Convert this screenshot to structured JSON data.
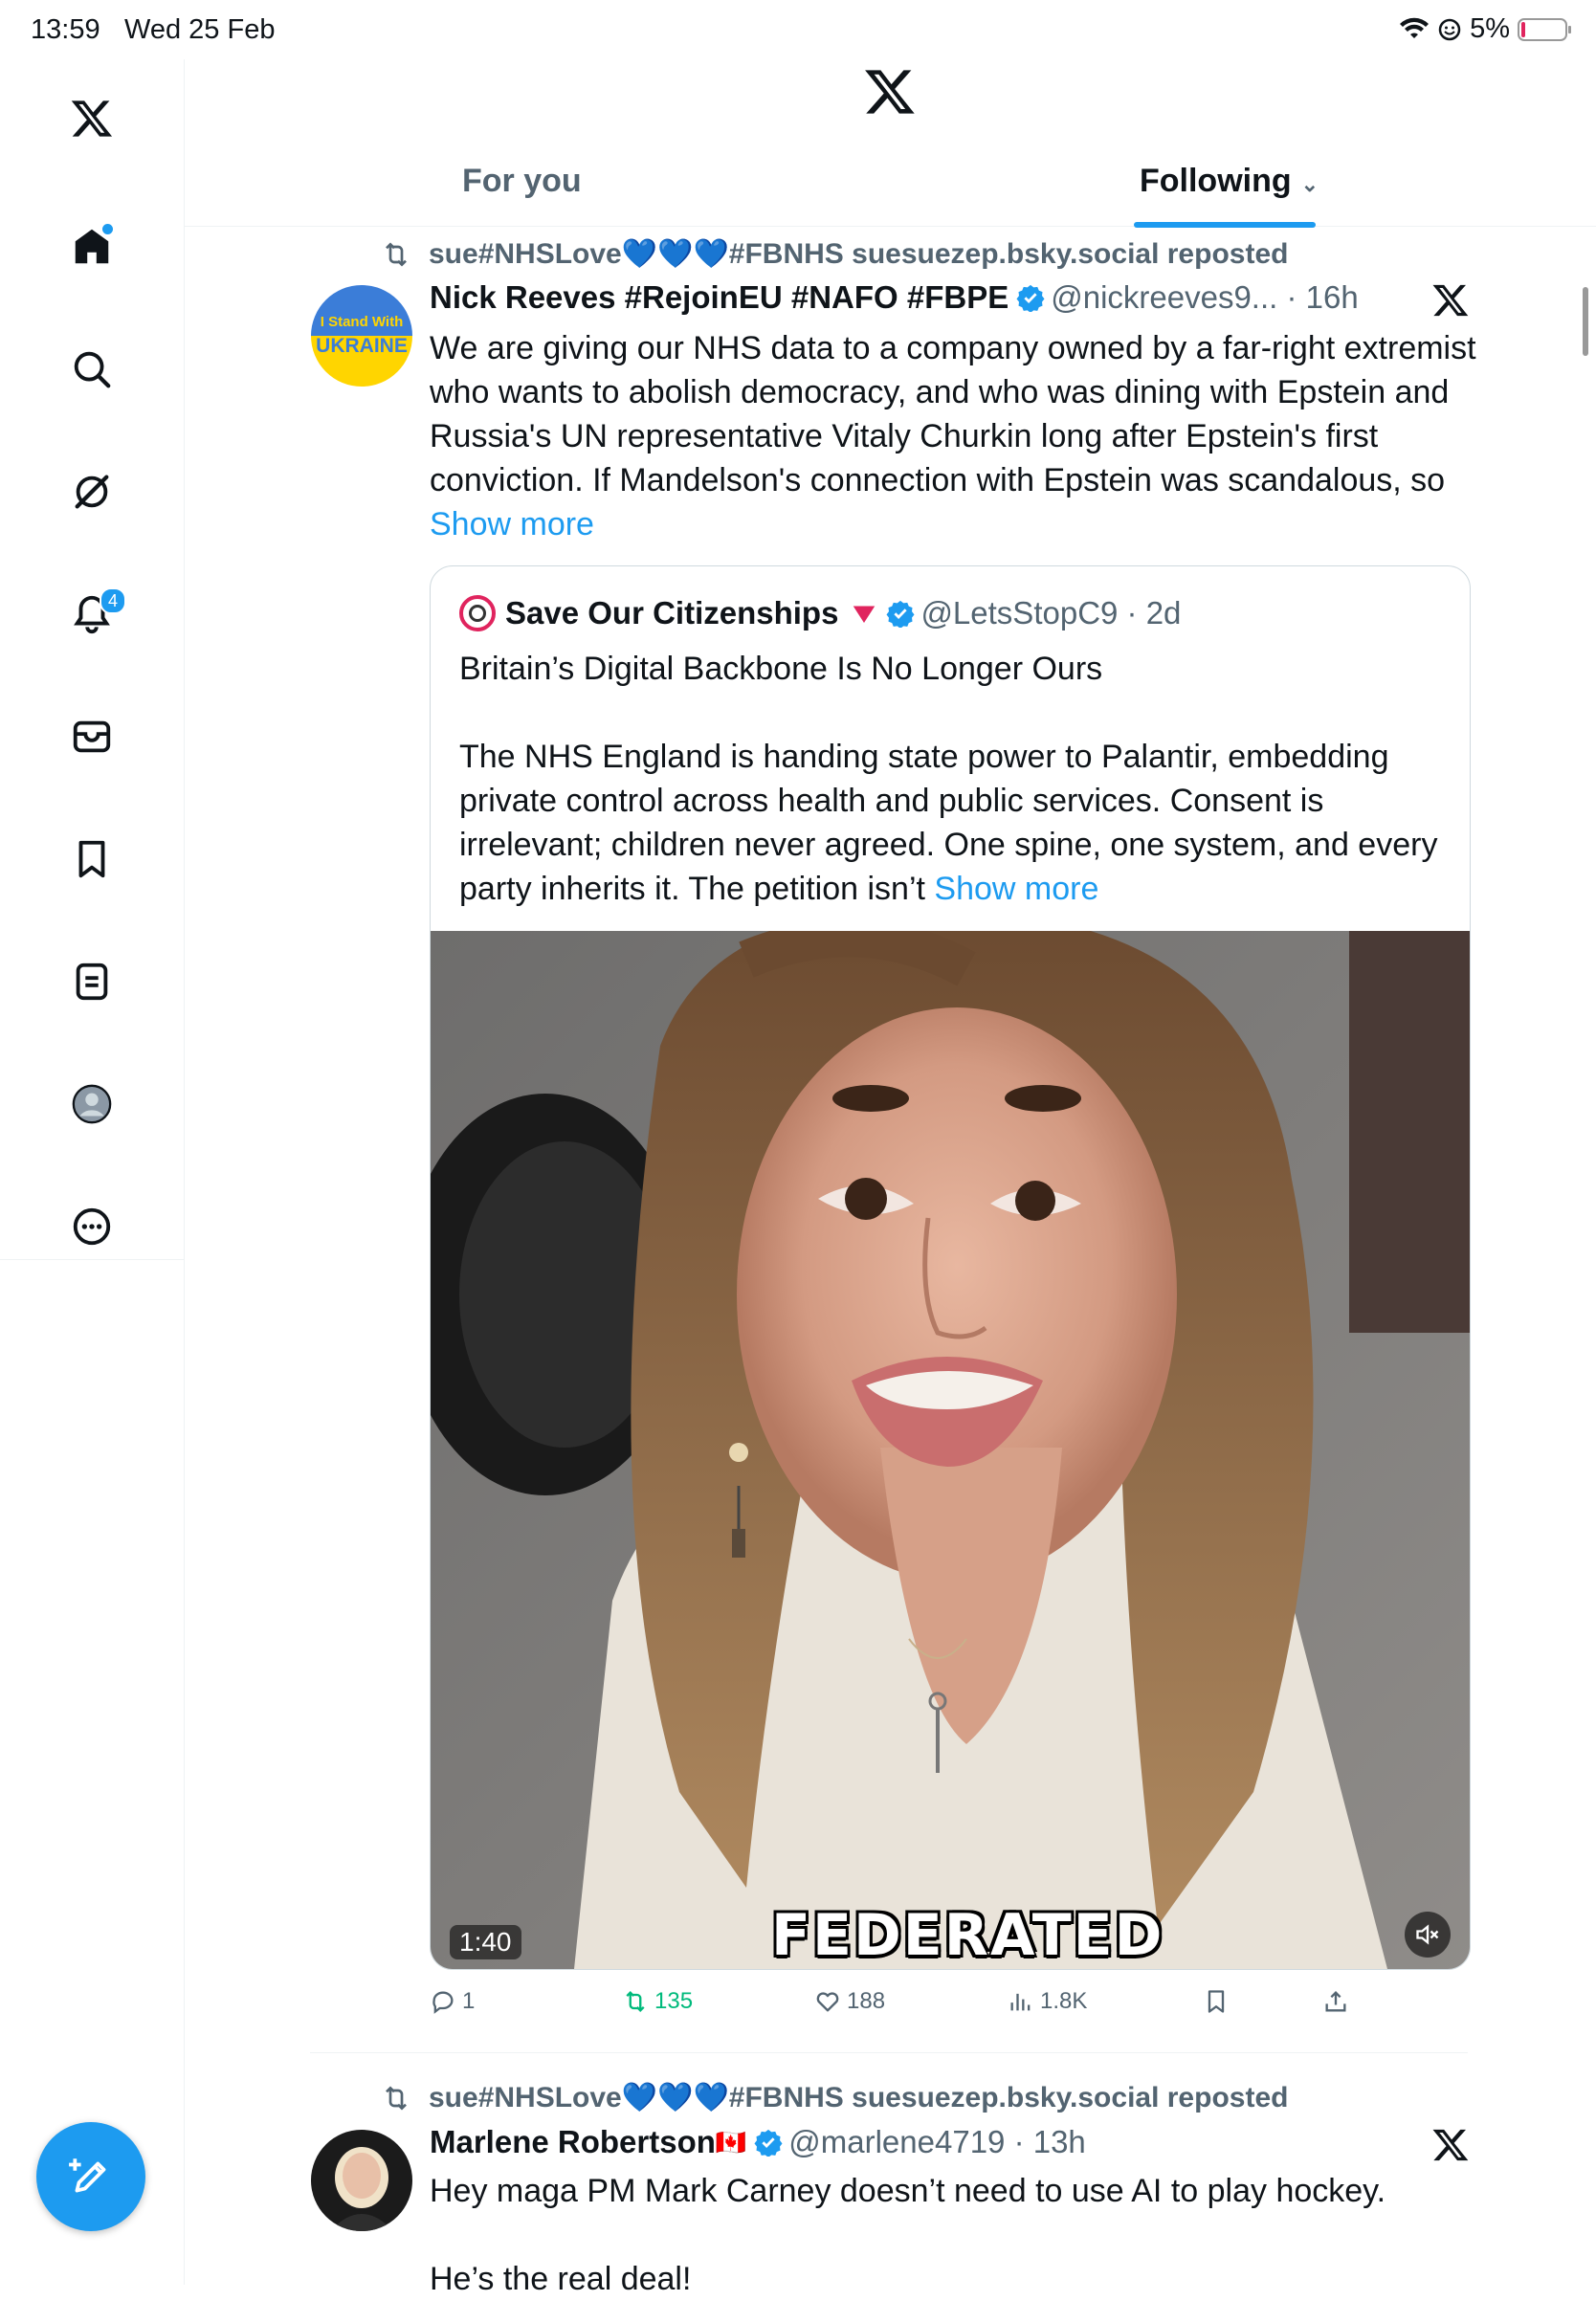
{
  "status_bar": {
    "time": "13:59",
    "date": "Wed 25 Feb",
    "battery": "5%"
  },
  "sidebar": {
    "notifications_badge": "4",
    "items": [
      "Home",
      "Search",
      "Grok",
      "Notifications",
      "Messages",
      "Bookmarks",
      "Lists",
      "Profile",
      "More"
    ]
  },
  "tabs": {
    "for_you": "For you",
    "following": "Following",
    "active": "following"
  },
  "posts": [
    {
      "repost_text": "sue#NHSLove💙💙💙#FBNHS suesuezep.bsky.social reposted",
      "author_name": "Nick Reeves #RejoinEU #NAFO #FBPE",
      "handle_time": "@nickreeves9... · 16h",
      "avatar_text_top": "I Stand With",
      "avatar_text_bottom": "UKRAINE",
      "text": "We are giving our NHS data to a company owned by a far-right extremist who wants to abolish democracy, and who was dining with Epstein and Russia's UN representative Vitaly Churkin long after Epstein's first conviction. If Mandelson's connection with Epstein was scandalous, so ",
      "show_more": "Show more",
      "quote": {
        "author_name": "Save Our Citizenships",
        "handle_time": "@LetsStopC9 · 2d",
        "title": "Britain’s Digital Backbone Is No Longer Ours",
        "text": "The NHS England is handing state power to Palantir, embedding private control across health and public services. Consent is irrelevant; children never agreed. One spine, one system, and every party inherits it. The petition isn’t ",
        "show_more": "Show more",
        "video_duration": "1:40",
        "video_caption": "FEDERATED"
      },
      "stats": {
        "replies": "1",
        "reposts": "135",
        "likes": "188",
        "views": "1.8K"
      }
    },
    {
      "repost_text": "sue#NHSLove💙💙💙#FBNHS suesuezep.bsky.social reposted",
      "author_name": "Marlene Robertson",
      "author_flag": "🇨🇦",
      "handle_time": "@marlene4719 · 13h",
      "text_line1": "Hey maga PM Mark Carney doesn’t need to use AI to play hockey.",
      "text_line2": "He’s the real deal!"
    }
  ],
  "colors": {
    "accent": "#1d9bf0",
    "repost_green": "#00ba7c",
    "secondary_text": "#536471"
  }
}
